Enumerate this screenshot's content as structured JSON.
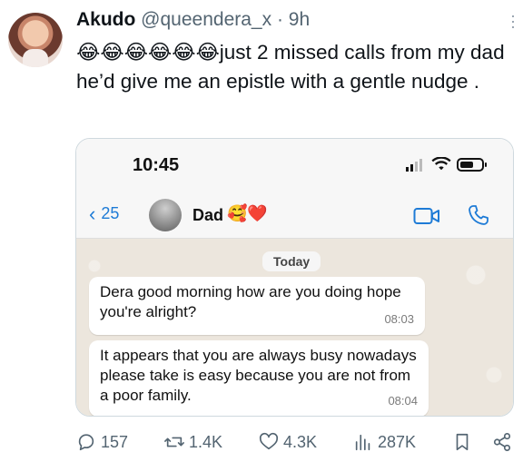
{
  "tweet": {
    "author_name": "Akudo",
    "handle": "@queendera_x",
    "separator": "·",
    "time_ago": "9h",
    "more_icon": "more-vertical-icon",
    "text": "😂😂😂😂😂😂just 2 missed calls from my dad he’d give me an epistle with a gentle nudge ."
  },
  "screenshot": {
    "status_time": "10:45",
    "back_count": "25",
    "contact_name": "Dad",
    "contact_emoji": "🥰❤️",
    "date_label": "Today",
    "messages": [
      {
        "text": "Dera  good morning how are you doing hope you're alright?",
        "time": "08:03"
      },
      {
        "text": "It appears that you are always busy nowadays  please  take is easy  because you are not from a  poor family.",
        "time": "08:04"
      }
    ],
    "accent_color": "#1e7bd6"
  },
  "actions": {
    "replies": "157",
    "reposts": "1.4K",
    "likes": "4.3K",
    "views": "287K"
  }
}
